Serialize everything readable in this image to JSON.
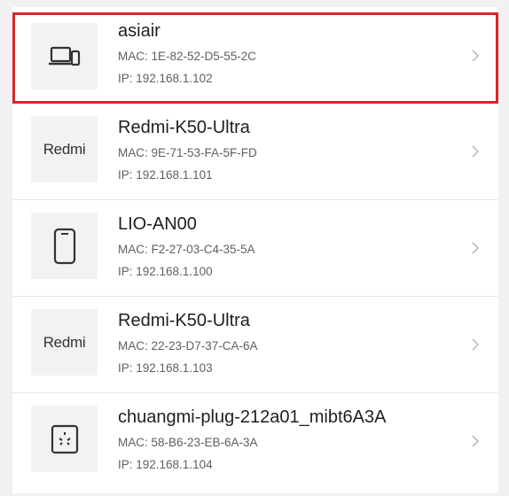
{
  "devices": [
    {
      "name": "asiair",
      "mac": "MAC: 1E-82-52-D5-55-2C",
      "ip": "IP: 192.168.1.102",
      "icon": "computer-icon",
      "brand": "",
      "selected": true
    },
    {
      "name": "Redmi-K50-Ultra",
      "mac": "MAC: 9E-71-53-FA-5F-FD",
      "ip": "IP: 192.168.1.101",
      "icon": "redmi-logo",
      "brand": "Redmi",
      "selected": false
    },
    {
      "name": "LIO-AN00",
      "mac": "MAC: F2-27-03-C4-35-5A",
      "ip": "IP: 192.168.1.100",
      "icon": "phone-icon",
      "brand": "",
      "selected": false
    },
    {
      "name": "Redmi-K50-Ultra",
      "mac": "MAC: 22-23-D7-37-CA-6A",
      "ip": "IP: 192.168.1.103",
      "icon": "redmi-logo",
      "brand": "Redmi",
      "selected": false
    },
    {
      "name": "chuangmi-plug-212a01_mibt6A3A",
      "mac": "MAC: 58-B6-23-EB-6A-3A",
      "ip": "IP: 192.168.1.104",
      "icon": "smart-plug-icon",
      "brand": "",
      "selected": false
    }
  ],
  "colors": {
    "selection_border": "#d9262b",
    "chevron": "#b5b5b5"
  }
}
